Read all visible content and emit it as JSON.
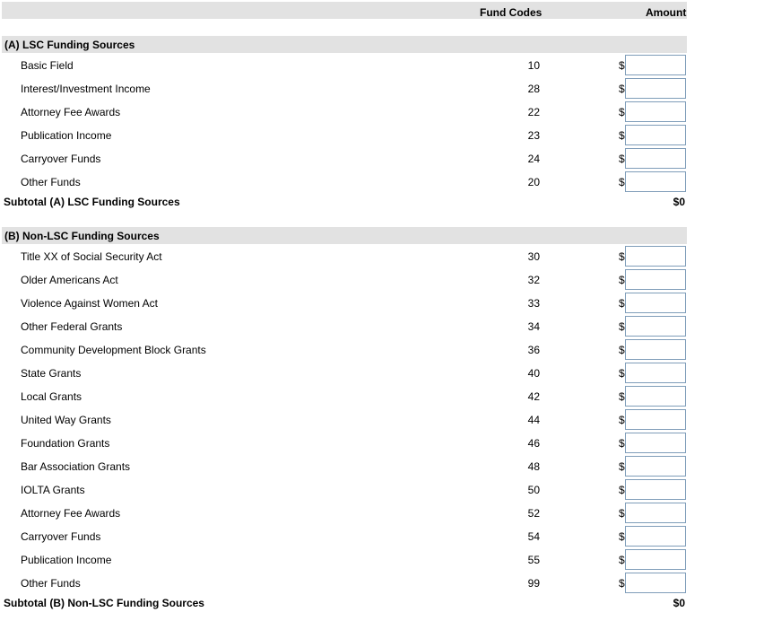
{
  "header": {
    "fund_codes": "Fund Codes",
    "amount": "Amount"
  },
  "section_a": {
    "title": "(A) LSC Funding Sources",
    "rows": [
      {
        "label": "Basic Field",
        "code": "10",
        "currency": "$",
        "value": ""
      },
      {
        "label": "Interest/Investment Income",
        "code": "28",
        "currency": "$",
        "value": ""
      },
      {
        "label": "Attorney Fee Awards",
        "code": "22",
        "currency": "$",
        "value": ""
      },
      {
        "label": "Publication Income",
        "code": "23",
        "currency": "$",
        "value": ""
      },
      {
        "label": "Carryover Funds",
        "code": "24",
        "currency": "$",
        "value": ""
      },
      {
        "label": "Other Funds",
        "code": "20",
        "currency": "$",
        "value": ""
      }
    ],
    "subtotal_label": "Subtotal (A) LSC Funding Sources",
    "subtotal_value": "$0"
  },
  "section_b": {
    "title": "(B) Non-LSC Funding Sources",
    "rows": [
      {
        "label": "Title XX of Social Security Act",
        "code": "30",
        "currency": "$",
        "value": ""
      },
      {
        "label": "Older Americans Act",
        "code": "32",
        "currency": "$",
        "value": ""
      },
      {
        "label": "Violence Against Women Act",
        "code": "33",
        "currency": "$",
        "value": ""
      },
      {
        "label": "Other Federal Grants",
        "code": "34",
        "currency": "$",
        "value": ""
      },
      {
        "label": "Community Development Block Grants",
        "code": "36",
        "currency": "$",
        "value": ""
      },
      {
        "label": "State Grants",
        "code": "40",
        "currency": "$",
        "value": ""
      },
      {
        "label": "Local Grants",
        "code": "42",
        "currency": "$",
        "value": ""
      },
      {
        "label": "United Way Grants",
        "code": "44",
        "currency": "$",
        "value": ""
      },
      {
        "label": "Foundation Grants",
        "code": "46",
        "currency": "$",
        "value": ""
      },
      {
        "label": "Bar Association Grants",
        "code": "48",
        "currency": "$",
        "value": ""
      },
      {
        "label": "IOLTA Grants",
        "code": "50",
        "currency": "$",
        "value": ""
      },
      {
        "label": "Attorney Fee Awards",
        "code": "52",
        "currency": "$",
        "value": ""
      },
      {
        "label": "Carryover Funds",
        "code": "54",
        "currency": "$",
        "value": ""
      },
      {
        "label": "Publication Income",
        "code": "55",
        "currency": "$",
        "value": ""
      },
      {
        "label": "Other Funds",
        "code": "99",
        "currency": "$",
        "value": ""
      }
    ],
    "subtotal_label": "Subtotal (B) Non-LSC Funding Sources",
    "subtotal_value": "$0"
  }
}
